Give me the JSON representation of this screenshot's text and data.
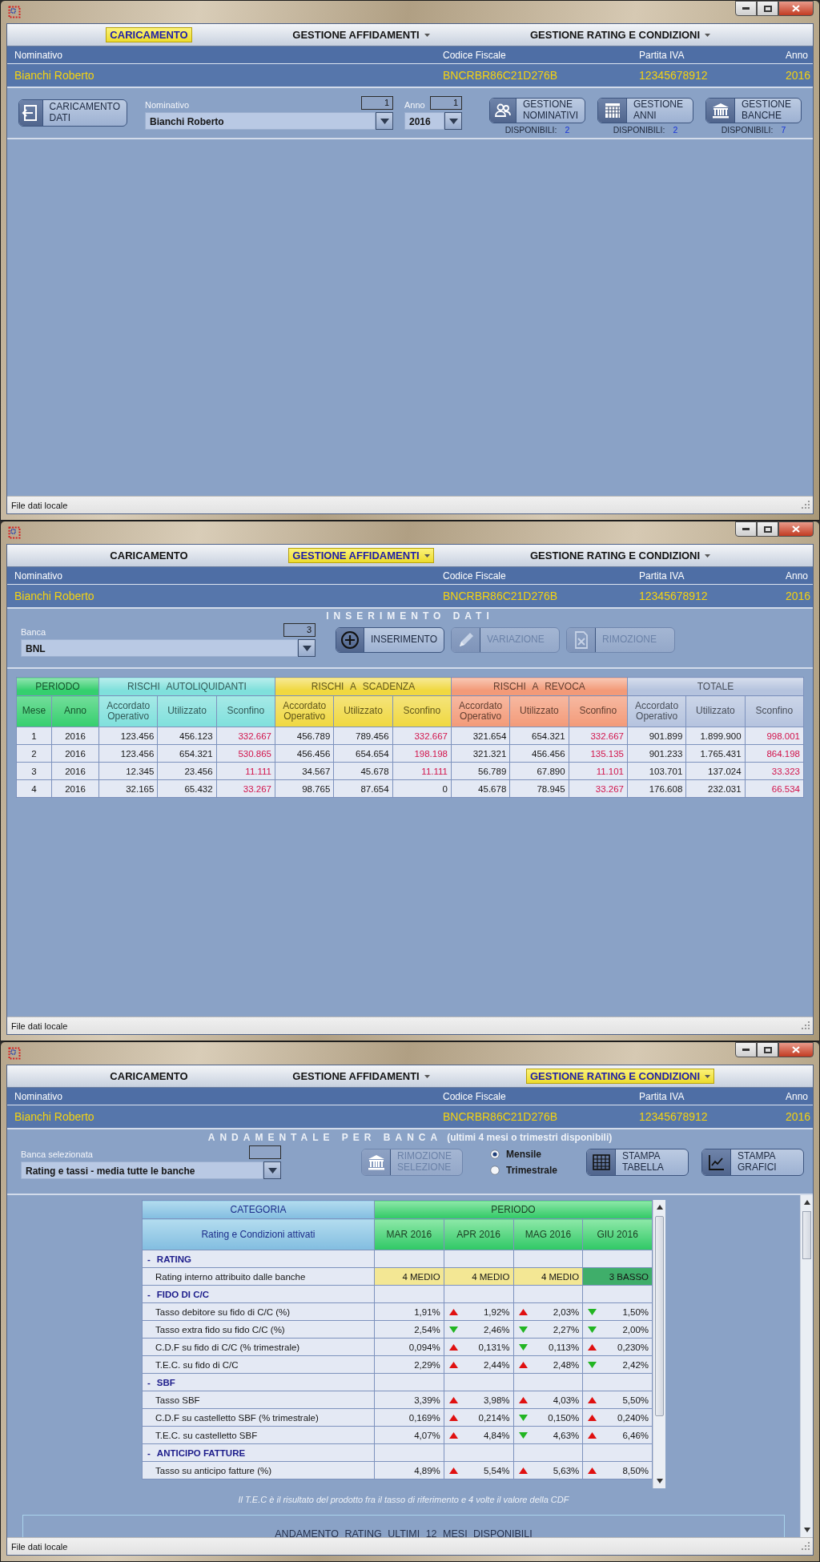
{
  "windows": [
    {
      "kind": "caricamento",
      "menu": [
        {
          "label": "CARICAMENTO",
          "selected": true,
          "dropdown": false
        },
        {
          "label": "GESTIONE AFFIDAMENTI",
          "selected": false,
          "dropdown": true
        },
        {
          "label": "GESTIONE RATING E CONDIZIONI",
          "selected": false,
          "dropdown": true
        }
      ],
      "client": [
        {
          "label": "Nominativo",
          "value": "Bianchi Roberto"
        },
        {
          "label": "Codice Fiscale",
          "value": "BNCRBR86C21D276B"
        },
        {
          "label": "Partita IVA",
          "value": "12345678912"
        },
        {
          "label": "Anno",
          "value": "2016"
        }
      ],
      "panel": {
        "load_button": {
          "kind": "load",
          "label": "CARICAMENTO DATI"
        },
        "fields": [
          {
            "label": "Nominativo",
            "counter": "1",
            "value": "Bianchi Roberto"
          },
          {
            "label": "Anno",
            "counter": "1",
            "value": "2016"
          }
        ],
        "manage_buttons": [
          {
            "kind": "people",
            "label": "GESTIONE NOMINATIVI",
            "available_label": "DISPONIBILI:",
            "count": "2"
          },
          {
            "kind": "calendar",
            "label": "GESTIONE ANNI",
            "available_label": "DISPONIBILI:",
            "count": "2"
          },
          {
            "kind": "bank",
            "label": "GESTIONE BANCHE",
            "available_label": "DISPONIBILI:",
            "count": "7"
          }
        ]
      },
      "status_bar": "File dati locale"
    },
    {
      "kind": "affidamenti",
      "menu": [
        {
          "label": "CARICAMENTO",
          "selected": false,
          "dropdown": false
        },
        {
          "label": "GESTIONE AFFIDAMENTI",
          "selected": true,
          "dropdown": true
        },
        {
          "label": "GESTIONE RATING E CONDIZIONI",
          "selected": false,
          "dropdown": true
        }
      ],
      "client": [
        {
          "label": "Nominativo",
          "value": "Bianchi Roberto"
        },
        {
          "label": "Codice Fiscale",
          "value": "BNCRBR86C21D276B"
        },
        {
          "label": "Partita IVA",
          "value": "12345678912"
        },
        {
          "label": "Anno",
          "value": "2016"
        }
      ],
      "panel": {
        "title": "INSERIMENTO DATI",
        "field": {
          "label": "Banca",
          "counter": "3",
          "value": "BNL"
        },
        "buttons": [
          {
            "kind": "plus",
            "label": "INSERIMENTO",
            "disabled": false
          },
          {
            "kind": "pencil",
            "label": "VARIAZIONE",
            "disabled": true
          },
          {
            "kind": "doc-x",
            "label": "RIMOZIONE",
            "disabled": true
          }
        ]
      },
      "table": {
        "groups": [
          {
            "label": "PERIODO",
            "color": "#35cf6e",
            "columns": [
              "Mese",
              "Anno"
            ]
          },
          {
            "label": "RISCHI AUTOLIQUIDANTI",
            "color": "#7fe0dc",
            "columns": [
              "Accordato Operativo",
              "Utilizzato",
              "Sconfino"
            ]
          },
          {
            "label": "RISCHI A SCADENZA",
            "color": "#f0d840",
            "columns": [
              "Accordato Operativo",
              "Utilizzato",
              "Sconfino"
            ]
          },
          {
            "label": "RISCHI A REVOCA",
            "color": "#f39a78",
            "columns": [
              "Accordato Operativo",
              "Utilizzato",
              "Sconfino"
            ]
          },
          {
            "label": "TOTALE",
            "color": "#b5c3de",
            "columns": [
              "Accordato Operativo",
              "Utilizzato",
              "Sconfino"
            ]
          }
        ],
        "rows": [
          {
            "cells": [
              "1",
              "2016",
              "123.456",
              "456.123",
              "332.667",
              "456.789",
              "789.456",
              "332.667",
              "321.654",
              "654.321",
              "332.667",
              "901.899",
              "1.899.900",
              "998.001"
            ],
            "overrun": [
              true,
              true,
              true,
              true
            ]
          },
          {
            "cells": [
              "2",
              "2016",
              "123.456",
              "654.321",
              "530.865",
              "456.456",
              "654.654",
              "198.198",
              "321.321",
              "456.456",
              "135.135",
              "901.233",
              "1.765.431",
              "864.198"
            ],
            "overrun": [
              true,
              true,
              true,
              true
            ]
          },
          {
            "cells": [
              "3",
              "2016",
              "12.345",
              "23.456",
              "11.111",
              "34.567",
              "45.678",
              "11.111",
              "56.789",
              "67.890",
              "11.101",
              "103.701",
              "137.024",
              "33.323"
            ],
            "overrun": [
              true,
              true,
              true,
              true
            ]
          },
          {
            "cells": [
              "4",
              "2016",
              "32.165",
              "65.432",
              "33.267",
              "98.765",
              "87.654",
              "0",
              "45.678",
              "78.945",
              "33.267",
              "176.608",
              "232.031",
              "66.534"
            ],
            "overrun": [
              true,
              false,
              true,
              true
            ]
          }
        ]
      },
      "status_bar": "File dati locale"
    },
    {
      "kind": "rating",
      "menu": [
        {
          "label": "CARICAMENTO",
          "selected": false,
          "dropdown": false
        },
        {
          "label": "GESTIONE AFFIDAMENTI",
          "selected": false,
          "dropdown": true
        },
        {
          "label": "GESTIONE RATING E CONDIZIONI",
          "selected": true,
          "dropdown": true
        }
      ],
      "client": [
        {
          "label": "Nominativo",
          "value": "Bianchi Roberto"
        },
        {
          "label": "Codice Fiscale",
          "value": "BNCRBR86C21D276B"
        },
        {
          "label": "Partita IVA",
          "value": "12345678912"
        },
        {
          "label": "Anno",
          "value": "2016"
        }
      ],
      "panel": {
        "title": "ANDAMENTALE PER BANCA",
        "subtitle": "(ultimi 4 mesi o trimestri disponibili)",
        "field": {
          "label": "Banca selezionata",
          "value": "Rating e tassi - media tutte le banche"
        },
        "remove_button": {
          "kind": "bank",
          "label": "RIMOZIONE SELEZIONE",
          "disabled": true
        },
        "radios": [
          {
            "label": "Mensile",
            "selected": true
          },
          {
            "label": "Trimestrale",
            "selected": false
          }
        ],
        "print_buttons": [
          {
            "kind": "table",
            "label": "STAMPA TABELLA",
            "disabled": false
          },
          {
            "kind": "chart",
            "label": "STAMPA GRAFICI",
            "disabled": false
          }
        ]
      },
      "table": {
        "category_header": "CATEGORIA",
        "period_header": "PERIODO",
        "category_subheader": "Rating e Condizioni attivati",
        "periods": [
          "MAR 2016",
          "APR 2016",
          "MAG 2016",
          "GIU 2016"
        ],
        "rows": [
          {
            "kind": "section",
            "toggle": "-",
            "label": "RATING"
          },
          {
            "kind": "rating",
            "label": "Rating interno attribuito dalle banche",
            "values": [
              {
                "text": "4 MEDIO",
                "color": "#f3e794"
              },
              {
                "text": "4 MEDIO",
                "color": "#f3e794"
              },
              {
                "text": "4 MEDIO",
                "color": "#f3e794"
              },
              {
                "text": "3 BASSO",
                "color": "#3fae6a"
              }
            ]
          },
          {
            "kind": "section",
            "toggle": "-",
            "label": "FIDO DI C/C"
          },
          {
            "kind": "item",
            "label": "Tasso debitore su fido di C/C (%)",
            "values": [
              {
                "text": "1,91%"
              },
              {
                "text": "1,92%",
                "increase": true
              },
              {
                "text": "2,03%",
                "increase": true
              },
              {
                "text": "1,50%",
                "increase": false
              }
            ]
          },
          {
            "kind": "item",
            "label": "Tasso extra fido su fido C/C (%)",
            "values": [
              {
                "text": "2,54%"
              },
              {
                "text": "2,46%",
                "increase": false
              },
              {
                "text": "2,27%",
                "increase": false
              },
              {
                "text": "2,00%",
                "increase": false
              }
            ]
          },
          {
            "kind": "item",
            "label": "C.D.F su fido di C/C (% trimestrale)",
            "values": [
              {
                "text": "0,094%"
              },
              {
                "text": "0,131%",
                "increase": true
              },
              {
                "text": "0,113%",
                "increase": false
              },
              {
                "text": "0,230%",
                "increase": true
              }
            ]
          },
          {
            "kind": "item",
            "label": "T.E.C. su fido di C/C",
            "values": [
              {
                "text": "2,29%"
              },
              {
                "text": "2,44%",
                "increase": true
              },
              {
                "text": "2,48%",
                "increase": true
              },
              {
                "text": "2,42%",
                "increase": false
              }
            ]
          },
          {
            "kind": "section",
            "toggle": "-",
            "label": "SBF"
          },
          {
            "kind": "item",
            "label": "Tasso SBF",
            "values": [
              {
                "text": "3,39%"
              },
              {
                "text": "3,98%",
                "increase": true
              },
              {
                "text": "4,03%",
                "increase": true
              },
              {
                "text": "5,50%",
                "increase": true
              }
            ]
          },
          {
            "kind": "item",
            "label": "C.D.F su castelletto SBF (% trimestrale)",
            "values": [
              {
                "text": "0,169%"
              },
              {
                "text": "0,214%",
                "increase": true
              },
              {
                "text": "0,150%",
                "increase": false
              },
              {
                "text": "0,240%",
                "increase": true
              }
            ]
          },
          {
            "kind": "item",
            "label": "T.E.C. su castelletto SBF",
            "values": [
              {
                "text": "4,07%"
              },
              {
                "text": "4,84%",
                "increase": true
              },
              {
                "text": "4,63%",
                "increase": false
              },
              {
                "text": "6,46%",
                "increase": true
              }
            ]
          },
          {
            "kind": "section",
            "toggle": "-",
            "label": "ANTICIPO FATTURE"
          },
          {
            "kind": "item",
            "label": "Tasso su anticipo fatture (%)",
            "values": [
              {
                "text": "4,89%"
              },
              {
                "text": "5,54%",
                "increase": true
              },
              {
                "text": "5,63%",
                "increase": true
              },
              {
                "text": "8,50%",
                "increase": true
              }
            ]
          }
        ]
      },
      "footnote": "Il T.E.C è il risultato del prodotto fra il tasso di riferimento e 4 volte il valore della CDF",
      "chart_title": "ANDAMENTO RATING ULTIMI 12 MESI DISPONIBILI",
      "status_bar": "File dati locale"
    }
  ]
}
